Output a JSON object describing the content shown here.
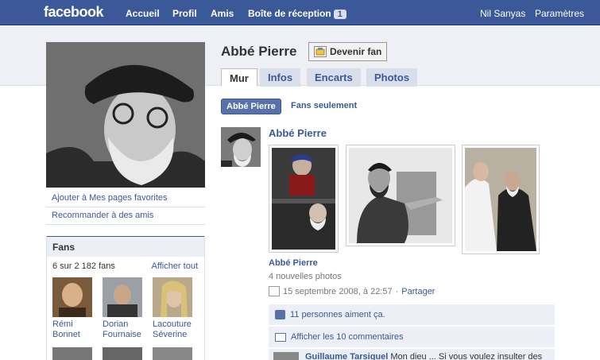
{
  "topbar": {
    "logo": "facebook",
    "nav": [
      "Accueil",
      "Profil",
      "Amis",
      "Boîte de réception"
    ],
    "inbox_count": "1",
    "user": "Nil Sanyas",
    "settings": "Paramètres"
  },
  "page": {
    "name": "Abbé Pierre",
    "fan_button": "Devenir fan",
    "tabs": [
      "Mur",
      "Infos",
      "Encarts",
      "Photos"
    ],
    "active_tab": "Mur"
  },
  "sidebar": {
    "links": [
      "Ajouter à Mes pages favorites",
      "Recommander à des amis"
    ],
    "fans_title": "Fans",
    "fans_count": "6 sur 2 182 fans",
    "fans_all": "Afficher tout",
    "fans": [
      {
        "first": "Rémi",
        "last": "Bonnet"
      },
      {
        "first": "Dorian",
        "last": "Fournaise"
      },
      {
        "first": "Lacouture",
        "last": "Séverine"
      }
    ]
  },
  "filters": {
    "active": "Abbé Pierre",
    "other": "Fans seulement"
  },
  "story": {
    "actor": "Abbé Pierre",
    "album_title": "Abbé Pierre",
    "album_sub": "4 nouvelles photos",
    "date": "15 septembre 2008, à 22:57",
    "separator": "·",
    "share": "Partager",
    "likes": "11 personnes aiment ça.",
    "comments_link": "Afficher les 10 commentaires",
    "comment_author": "Guillaume Tarsiquel",
    "comment_text": "Mon dieu ... Si vous voulez insulter des"
  },
  "colors": {
    "brand": "#3b5998",
    "band": "#eef0f5",
    "feed": "#eceff5"
  }
}
